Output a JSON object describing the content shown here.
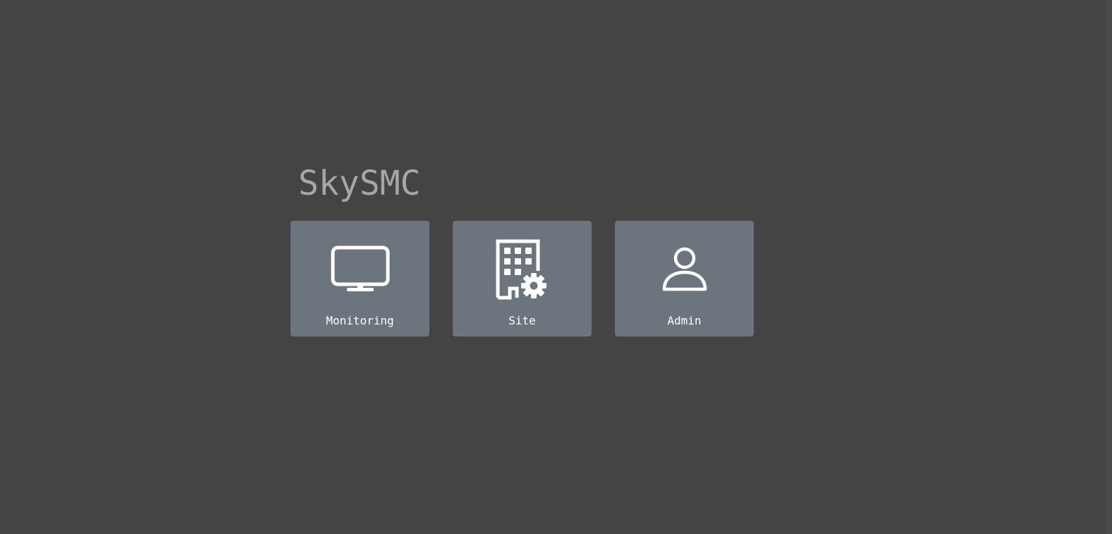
{
  "app": {
    "title": "SkySMC"
  },
  "tiles": [
    {
      "label": "Monitoring",
      "icon": "monitor-icon"
    },
    {
      "label": "Site",
      "icon": "building-gear-icon"
    },
    {
      "label": "Admin",
      "icon": "person-icon"
    }
  ],
  "colors": {
    "background": "#444444",
    "tile": "#6c757d",
    "title": "#a6a6a6",
    "icon": "#ffffff"
  }
}
